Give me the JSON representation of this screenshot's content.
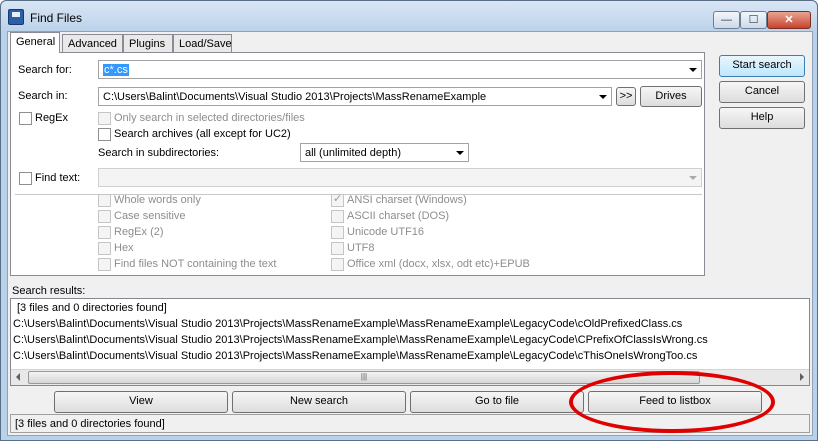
{
  "window": {
    "title": "Find Files",
    "min": "—",
    "max": "☐",
    "close": "✕"
  },
  "tabs": [
    "General",
    "Advanced",
    "Plugins",
    "Load/Save"
  ],
  "search_for": {
    "label": "Search for:",
    "value": "c*.cs"
  },
  "search_in": {
    "label": "Search in:",
    "value": "C:\\Users\\Balint\\Documents\\Visual Studio 2013\\Projects\\MassRenameExample",
    "more": ">>",
    "drives": "Drives"
  },
  "regex": {
    "label": "RegEx"
  },
  "only_selected": {
    "label": "Only search in selected directories/files"
  },
  "search_archives": {
    "label": "Search archives (all except for UC2)"
  },
  "subdirs": {
    "label": "Search in subdirectories:",
    "value": "all (unlimited depth)"
  },
  "find_text": {
    "label": "Find text:"
  },
  "options_left": [
    "Whole words only",
    "Case sensitive",
    "RegEx (2)",
    "Hex",
    "Find files NOT containing the text"
  ],
  "options_right": [
    "ANSI charset (Windows)",
    "ASCII charset (DOS)",
    "Unicode UTF16",
    "UTF8",
    "Office xml (docx, xlsx, odt etc)+EPUB"
  ],
  "side_buttons": {
    "start": "Start search",
    "cancel": "Cancel",
    "help": "Help"
  },
  "results": {
    "label": "Search results:",
    "lines": [
      "[3 files and 0 directories found]",
      "C:\\Users\\Balint\\Documents\\Visual Studio 2013\\Projects\\MassRenameExample\\MassRenameExample\\LegacyCode\\cOldPrefixedClass.cs",
      "C:\\Users\\Balint\\Documents\\Visual Studio 2013\\Projects\\MassRenameExample\\MassRenameExample\\LegacyCode\\CPrefixOfClassIsWrong.cs",
      "C:\\Users\\Balint\\Documents\\Visual Studio 2013\\Projects\\MassRenameExample\\MassRenameExample\\LegacyCode\\cThisOneIsWrongToo.cs"
    ],
    "thumb": "|||"
  },
  "bottom_buttons": {
    "view": "View",
    "new_search": "New search",
    "goto": "Go to file",
    "feed": "Feed to listbox"
  },
  "status": "[3 files and 0 directories found]",
  "colors": {
    "highlight": "#3399ff",
    "annotation": "#e00000"
  }
}
